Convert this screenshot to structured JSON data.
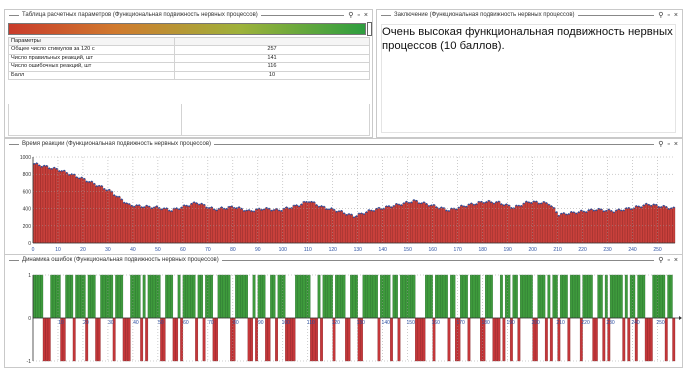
{
  "panels": {
    "params": {
      "title": "Таблица расчетных параметров (Функциональная подвижность нервных процессов)",
      "header": "Параметры",
      "rows": [
        {
          "label": "Общее число стимулов за 120 с",
          "value": "257"
        },
        {
          "label": "Число правильных реакций, шт",
          "value": "141"
        },
        {
          "label": "Число ошибочных реакций, шт",
          "value": "116"
        },
        {
          "label": "Балл",
          "value": "10"
        }
      ],
      "gradient_colors": [
        "#c93b2b",
        "#d07a2e",
        "#9eb23b",
        "#2e9e3f"
      ]
    },
    "conclusion": {
      "title": "Заключение (Функциональная подвижность нервных процессов)",
      "text": "Очень высокая функциональная подвижность нервных процессов (10 баллов)."
    },
    "reaction": {
      "title": "Время реакции (Функциональная подвижность нервных процессов)"
    },
    "errors": {
      "title": "Динамика ошибок (Функциональная подвижность нервных процессов)"
    },
    "window_buttons": {
      "pin": "⚲",
      "restore": "▫",
      "close": "×"
    }
  },
  "chart_data": [
    {
      "type": "bar",
      "name": "reaction-time",
      "bar_color": "#c8403b",
      "points": [
        [
          0,
          920
        ],
        [
          10,
          850
        ],
        [
          20,
          740
        ],
        [
          30,
          610
        ],
        [
          38,
          440
        ],
        [
          50,
          410
        ],
        [
          55,
          380
        ],
        [
          65,
          470
        ],
        [
          72,
          390
        ],
        [
          80,
          420
        ],
        [
          86,
          370
        ],
        [
          92,
          400
        ],
        [
          98,
          380
        ],
        [
          106,
          440
        ],
        [
          110,
          490
        ],
        [
          115,
          420
        ],
        [
          122,
          370
        ],
        [
          128,
          310
        ],
        [
          135,
          380
        ],
        [
          140,
          410
        ],
        [
          148,
          460
        ],
        [
          152,
          490
        ],
        [
          160,
          430
        ],
        [
          166,
          380
        ],
        [
          172,
          430
        ],
        [
          180,
          480
        ],
        [
          186,
          470
        ],
        [
          192,
          410
        ],
        [
          198,
          480
        ],
        [
          206,
          460
        ],
        [
          210,
          330
        ],
        [
          218,
          360
        ],
        [
          225,
          390
        ],
        [
          232,
          370
        ],
        [
          240,
          410
        ],
        [
          246,
          450
        ],
        [
          252,
          420
        ],
        [
          256,
          400
        ]
      ],
      "x_ticks": [
        "0",
        "10",
        "20",
        "30",
        "40",
        "50",
        "60",
        "70",
        "80",
        "90",
        "100",
        "110",
        "120",
        "130",
        "140",
        "150",
        "160",
        "170",
        "180",
        "190",
        "200",
        "210",
        "220",
        "230",
        "240",
        "250"
      ],
      "y_ticks": [
        "0",
        "200",
        "400",
        "600",
        "800",
        "1000"
      ],
      "xlim": [
        0,
        257
      ],
      "ylim": [
        0,
        1000
      ],
      "grid": true
    },
    {
      "type": "bar",
      "name": "error-dynamics",
      "colors": {
        "correct": "#3e9a3c",
        "error": "#c4373a"
      },
      "pattern": "1111000111100111011110111001111101110001111010111110011100101111101101110011111001111100101110011011100001111110001011110111100111001111110111101101111110000111011111011001110111100111000101101101111100111010110111011110111100110101111101011011100011111011010",
      "x_ticks": [
        "10",
        "20",
        "30",
        "40",
        "50",
        "60",
        "70",
        "80",
        "90",
        "100",
        "110",
        "120",
        "130",
        "140",
        "150",
        "160",
        "170",
        "180",
        "190",
        "200",
        "210",
        "220",
        "230",
        "240",
        "250"
      ],
      "y_ticks": [
        "1",
        "0",
        "-1"
      ],
      "xlim": [
        0,
        257
      ],
      "ylim": [
        -1,
        1
      ],
      "grid": true
    }
  ]
}
